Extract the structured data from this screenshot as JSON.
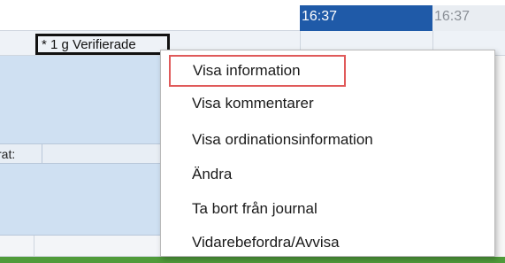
{
  "times": {
    "active": "16:37",
    "inactive": "16:37"
  },
  "cell": {
    "verified_text": "* 1 g Verifierade"
  },
  "left_label": "rat:",
  "context_menu": {
    "items": [
      {
        "label": "Visa information",
        "highlighted": true
      },
      {
        "label": "Visa kommentarer"
      },
      {
        "label": "Visa ordinationsinformation"
      },
      {
        "label": "Ändra"
      },
      {
        "label": "Ta bort från journal"
      },
      {
        "label": "Vidarebefordra/Avvisa"
      }
    ]
  },
  "colors": {
    "time_active_bg": "#1f5aa8",
    "highlight_border": "#e05a5a",
    "status_bar": "#4f9b3a"
  }
}
